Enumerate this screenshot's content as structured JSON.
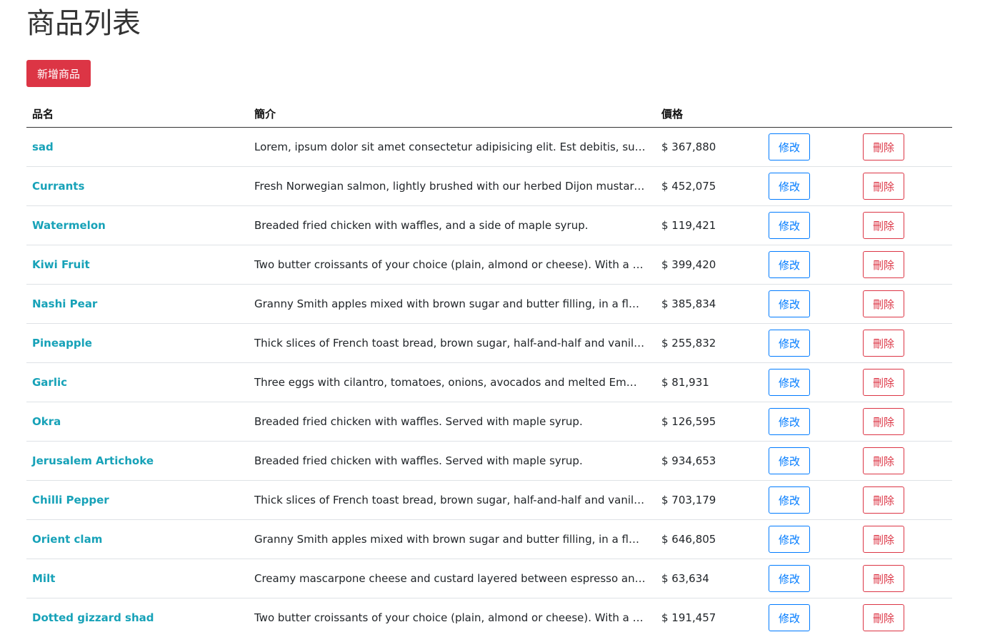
{
  "page": {
    "title": "商品列表",
    "add_button_label": "新增商品"
  },
  "table": {
    "headers": {
      "name": "品名",
      "description": "簡介",
      "price": "價格"
    },
    "edit_label": "修改",
    "delete_label": "刪除",
    "rows": [
      {
        "name": "sad",
        "description": "Lorem, ipsum dolor sit amet consectetur adipisicing elit. Est debitis, sunt ape...",
        "price": "$ 367,880"
      },
      {
        "name": "Currants",
        "description": "Fresh Norwegian salmon, lightly brushed with our herbed Dijon mustard sau...",
        "price": "$ 452,075"
      },
      {
        "name": "Watermelon",
        "description": "Breaded fried chicken with waffles, and a side of maple syrup.",
        "price": "$ 119,421"
      },
      {
        "name": "Kiwi Fruit",
        "description": "Two butter croissants of your choice (plain, almond or cheese). With a side of...",
        "price": "$ 399,420"
      },
      {
        "name": "Nashi Pear",
        "description": "Granny Smith apples mixed with brown sugar and butter filling, in a flaky all-...",
        "price": "$ 385,834"
      },
      {
        "name": "Pineapple",
        "description": "Thick slices of French toast bread, brown sugar, half-and-half and vanilla, top...",
        "price": "$ 255,832"
      },
      {
        "name": "Garlic",
        "description": "Three eggs with cilantro, tomatoes, onions, avocados and melted Emmental ...",
        "price": "$ 81,931"
      },
      {
        "name": "Okra",
        "description": "Breaded fried chicken with waffles. Served with maple syrup.",
        "price": "$ 126,595"
      },
      {
        "name": "Jerusalem Artichoke",
        "description": "Breaded fried chicken with waffles. Served with maple syrup.",
        "price": "$ 934,653"
      },
      {
        "name": "Chilli Pepper",
        "description": "Thick slices of French toast bread, brown sugar, half-and-half and vanilla, top...",
        "price": "$ 703,179"
      },
      {
        "name": "Orient clam",
        "description": "Granny Smith apples mixed with brown sugar and butter filling, in a flaky all-...",
        "price": "$ 646,805"
      },
      {
        "name": "Milt",
        "description": "Creamy mascarpone cheese and custard layered between espresso and rum ...",
        "price": "$ 63,634"
      },
      {
        "name": "Dotted gizzard shad",
        "description": "Two butter croissants of your choice (plain, almond or cheese). With a side of...",
        "price": "$ 191,457"
      }
    ]
  },
  "colors": {
    "danger": "#dc3545",
    "primary": "#007bff",
    "info": "#17a2b8"
  }
}
